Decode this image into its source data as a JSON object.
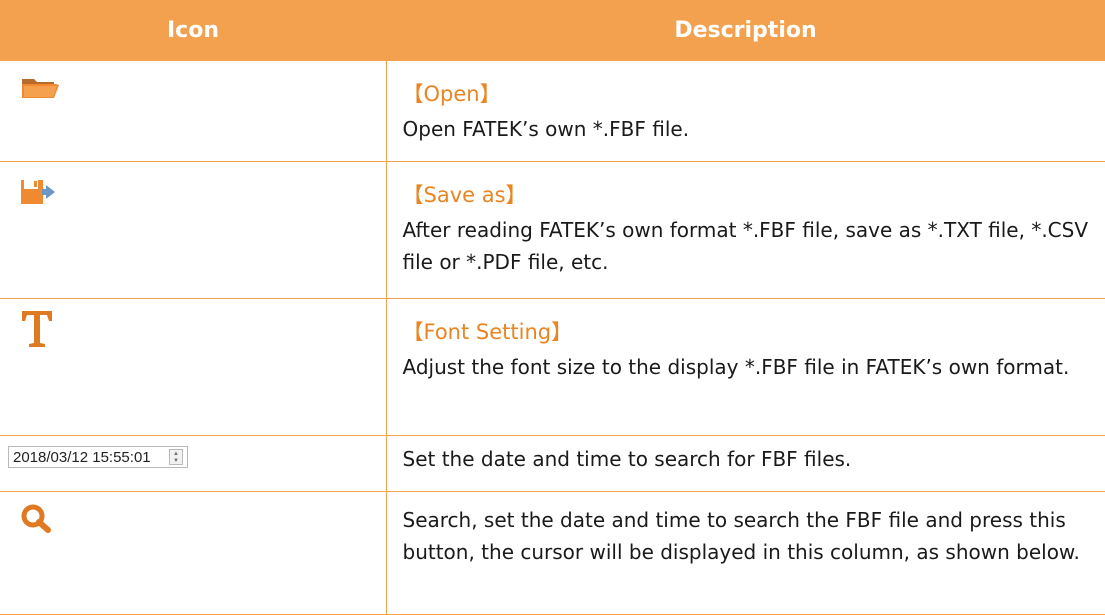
{
  "table": {
    "headers": {
      "icon": "Icon",
      "description": "Description"
    },
    "rows": [
      {
        "icon": "folder-open-icon",
        "title": "【Open】",
        "text": "Open FATEK’s own *.FBF file."
      },
      {
        "icon": "save-as-icon",
        "title": "【Save as】",
        "text": "After reading FATEK’s own format *.FBF file, save as *.TXT file, *.CSV file or *.PDF file, etc."
      },
      {
        "icon": "font-setting-icon",
        "title": "【Font Setting】",
        "text": "Adjust the font size to the display *.FBF file in FATEK’s own format."
      },
      {
        "datetime_value": "2018/03/12 15:55:01",
        "text": "Set the date and time to search for FBF files."
      },
      {
        "icon": "search-icon",
        "text": "Search, set the date and time to search the FBF file and press this button, the cursor will be displayed in this column, as shown below."
      }
    ]
  },
  "colors": {
    "header_bg": "#f3a14f",
    "accent_text": "#e98522",
    "border": "#f3a14f"
  }
}
